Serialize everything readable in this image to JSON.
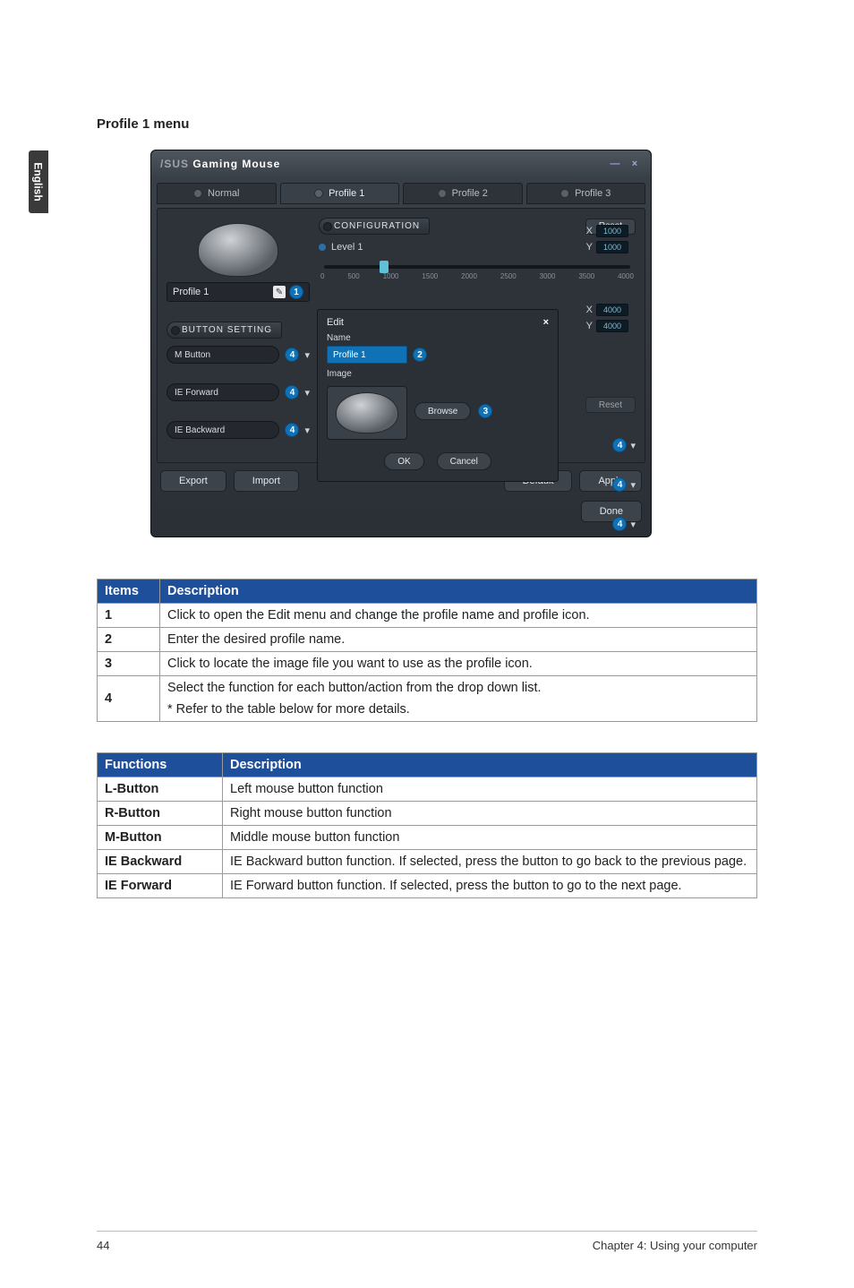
{
  "sideTab": "English",
  "heading": "Profile 1 menu",
  "app": {
    "brand_prefix": "/SUS",
    "brand_rest": " Gaming Mouse",
    "window_min": "—",
    "window_close": "×",
    "tabs": {
      "normal": "Normal",
      "p1": "Profile 1",
      "p2": "Profile 2",
      "p3": "Profile 3"
    },
    "config_label": "CONFIGURATION",
    "reset": "Reset",
    "level_label": "Level 1",
    "ticks": [
      "0",
      "500",
      "1000",
      "1500",
      "2000",
      "2500",
      "3000",
      "3500",
      "4000"
    ],
    "xy": {
      "x_label": "X",
      "y_label": "Y",
      "x1": "1000",
      "y1": "1000",
      "x2": "4000",
      "y2": "4000"
    },
    "profile_chip": "Profile 1",
    "button_setting": "BUTTON SETTING",
    "rows": {
      "mbutton": "M Button",
      "ieforward": "IE Forward",
      "iebackward": "IE Backward"
    },
    "edit": {
      "title": "Edit",
      "close": "×",
      "name_label": "Name",
      "name_value": "Profile 1",
      "image_label": "Image",
      "browse": "Browse",
      "ok": "OK",
      "cancel": "Cancel"
    },
    "bottom": {
      "export": "Export",
      "import": "Import",
      "default": "Default",
      "apply": "Apply",
      "done": "Done"
    },
    "badges": {
      "b1": "1",
      "b2": "2",
      "b3": "3",
      "b4": "4"
    }
  },
  "itemsTable": {
    "h_items": "Items",
    "h_desc": "Description",
    "rows": [
      {
        "n": "1",
        "d": "Click to open the Edit menu and change the profile name and profile icon."
      },
      {
        "n": "2",
        "d": "Enter the desired profile name."
      },
      {
        "n": "3",
        "d": "Click to locate the image file you want to use as the profile icon."
      },
      {
        "n": "4",
        "d1": "Select the function for each button/action from the drop down list.",
        "d2": "* Refer to the table below for more details."
      }
    ]
  },
  "funcTable": {
    "h_func": "Functions",
    "h_desc": "Description",
    "rows": [
      {
        "f": "L-Button",
        "d": "Left mouse button function"
      },
      {
        "f": "R-Button",
        "d": "Right mouse button function"
      },
      {
        "f": "M-Button",
        "d": "Middle mouse button function"
      },
      {
        "f": "IE Backward",
        "d": "IE Backward button function. If selected, press the button to go back to the previous page."
      },
      {
        "f": "IE Forward",
        "d": "IE Forward button function. If selected, press the button to go to the next page."
      }
    ]
  },
  "footer": {
    "page": "44",
    "chapter": "Chapter 4: Using your computer"
  }
}
